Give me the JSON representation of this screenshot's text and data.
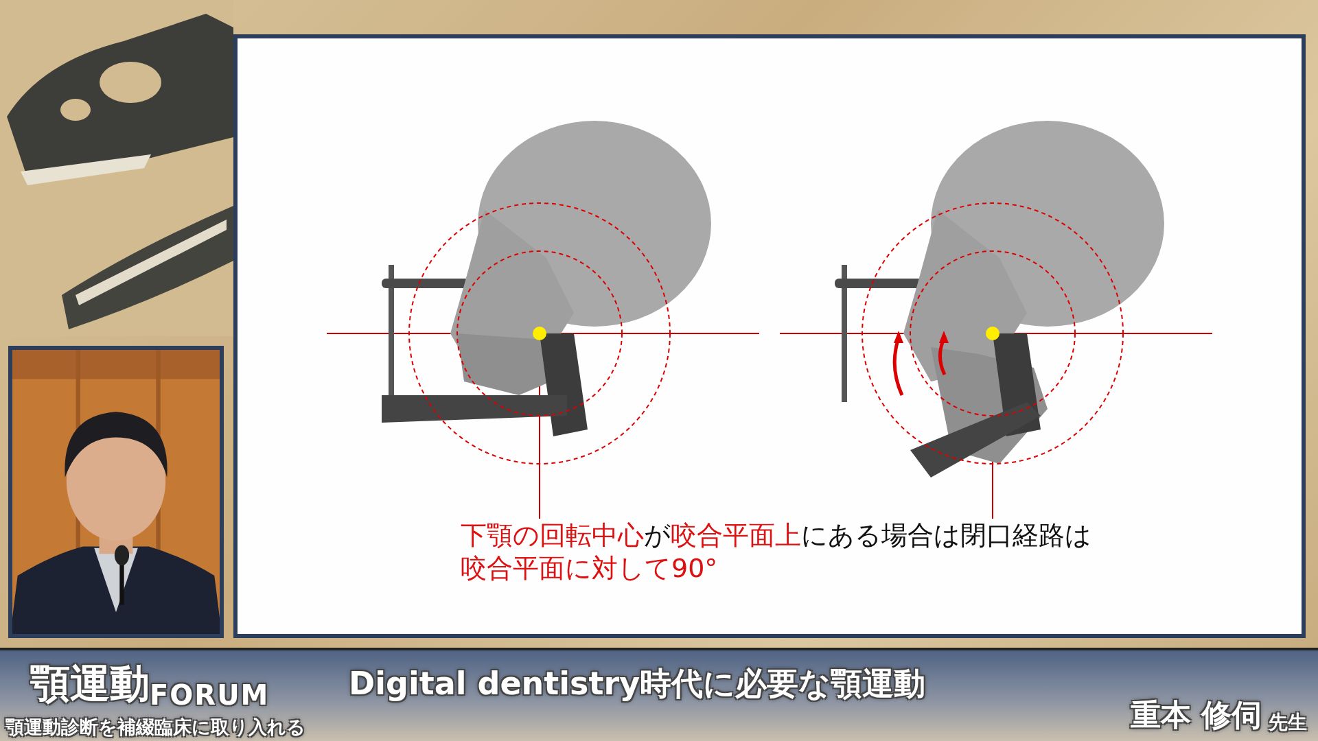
{
  "slide": {
    "figures": [
      {
        "mouth_open": false
      },
      {
        "mouth_open": true
      }
    ],
    "caption": [
      [
        {
          "text": "下顎の回転中心",
          "emphasis": true
        },
        {
          "text": "が",
          "emphasis": false
        },
        {
          "text": "咬合平面上",
          "emphasis": true
        },
        {
          "text": "にある場合は閉口経路は",
          "emphasis": false
        }
      ],
      [
        {
          "text": "咬合平面に対して90°",
          "emphasis": true
        }
      ]
    ]
  },
  "logo": {
    "title": "顎運動",
    "forum": "FORUM",
    "subtitle": "顎運動診断を補綴臨床に取り入れる"
  },
  "talk_title": "Digital dentistry時代に必要な顎運動",
  "speaker": {
    "name": "重本 修伺",
    "honorific": "先生"
  }
}
